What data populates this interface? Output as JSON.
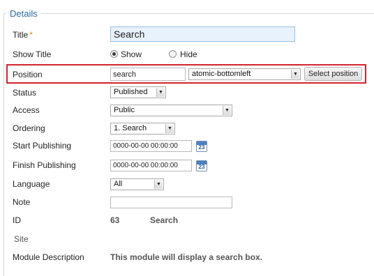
{
  "legend": "Details",
  "colors": {
    "legend": "#2c6aa4",
    "required_star": "#e08a00",
    "highlight_border": "#d3242c",
    "title_input_bg": "#e8f2fc"
  },
  "labels": {
    "title": "Title",
    "title_required": "*",
    "show_title": "Show Title",
    "position": "Position",
    "status": "Status",
    "access": "Access",
    "ordering": "Ordering",
    "start_publishing": "Start Publishing",
    "finish_publishing": "Finish Publishing",
    "language": "Language",
    "note": "Note",
    "id": "ID",
    "site": "Site",
    "module_description": "Module Description"
  },
  "fields": {
    "title_value": "Search",
    "show_title_options": [
      "Show",
      "Hide"
    ],
    "show_title_selected": "Show",
    "position_value": "search",
    "position_select": "atomic-bottomleft",
    "select_position_button": "Select position",
    "status_value": "Published",
    "access_value": "Public",
    "ordering_value": "1. Search",
    "start_publishing_value": "0000-00-00 00:00:00",
    "finish_publishing_value": "0000-00-00 00:00:00",
    "language_value": "All",
    "note_value": "",
    "id_value": "63",
    "module_type": "Search",
    "module_description": "This module will display a search box."
  },
  "icons": {
    "calendar": "calendar-icon",
    "dropdown": "chevron-down-icon",
    "calendar_glyph": "23",
    "dropdown_glyph": "▼"
  }
}
